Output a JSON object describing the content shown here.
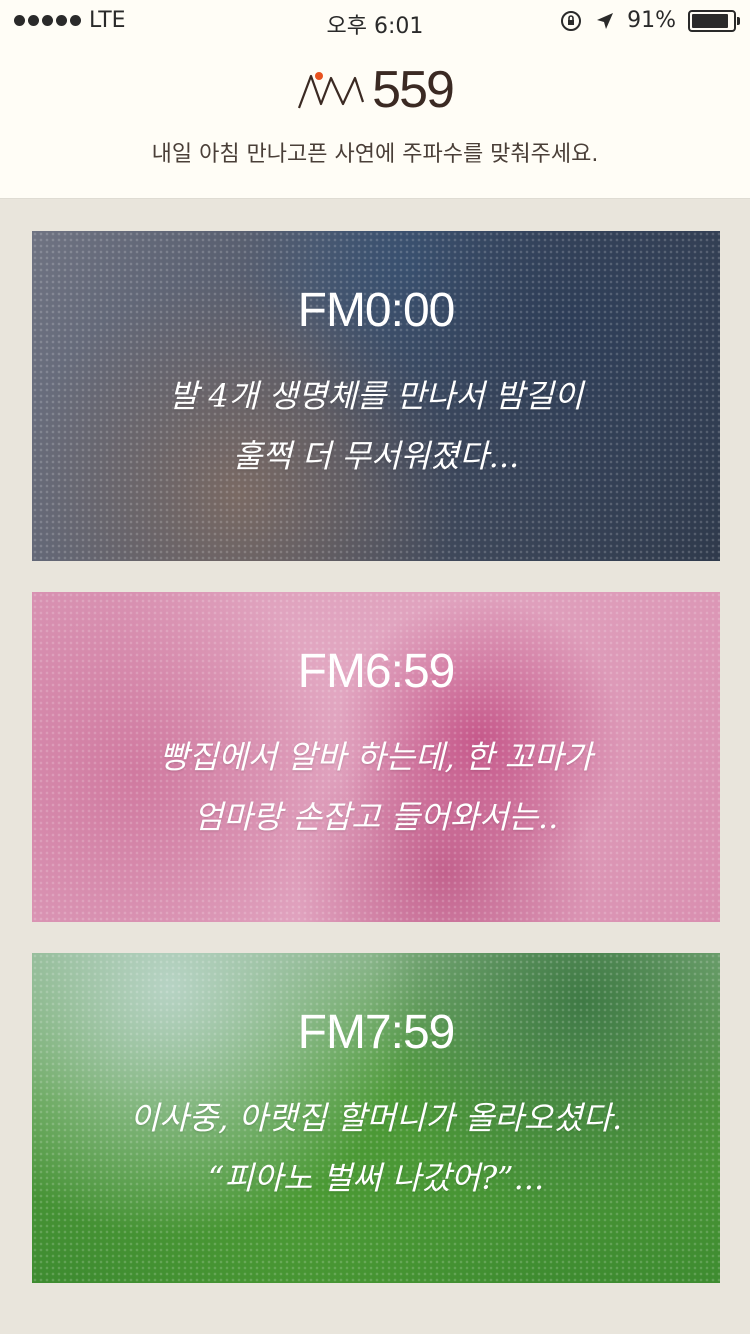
{
  "status_bar": {
    "carrier": "LTE",
    "time": "오후 6:01",
    "battery": "91%",
    "icons": [
      "signal-dots",
      "orientation-lock-icon",
      "location-arrow-icon",
      "battery-icon"
    ]
  },
  "header": {
    "logo_text": "559",
    "tagline": "내일 아침 만나고픈 사연에 주파수를 맞춰주세요.",
    "accent_color": "#e8521f"
  },
  "cards": [
    {
      "time": "FM0:00",
      "line1": "발 4개 생명체를 만나서 밤길이",
      "line2": "훌쩍 더 무서워졌다..."
    },
    {
      "time": "FM6:59",
      "line1": "빵집에서 알바 하는데, 한 꼬마가",
      "line2": "엄마랑 손잡고 들어와서는.."
    },
    {
      "time": "FM7:59",
      "line1": "이사중, 아랫집 할머니가 올라오셨다.",
      "line2": "“피아노 벌써 나갔어?”..."
    }
  ]
}
